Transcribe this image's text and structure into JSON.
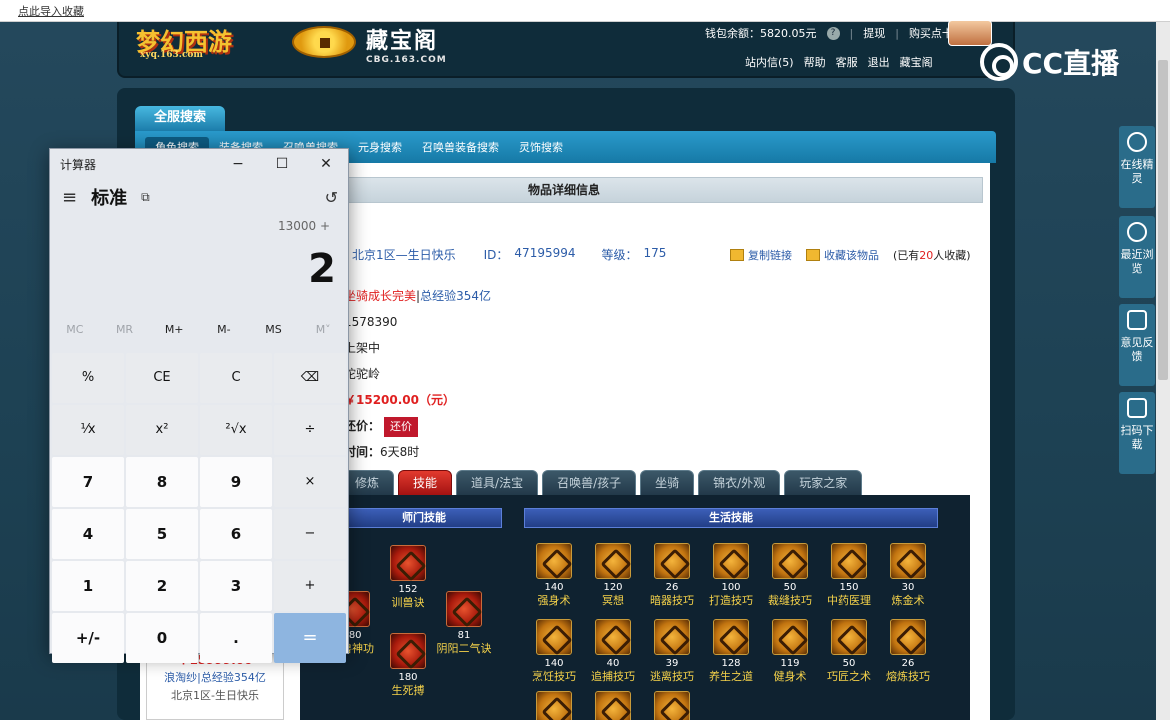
{
  "browser": {
    "bookmark_link": "点此导入收藏"
  },
  "header": {
    "logo_game": "梦幻西游",
    "logo_game_url": "xyq.163.com",
    "logo_site": "藏宝阁",
    "logo_site_url": "CBG.163.COM",
    "wallet_label": "钱包余额：5820.05元",
    "wallet_help": "?",
    "withdraw": "提现",
    "buy_card": "购买点卡",
    "user_nav": [
      "站内信(5)",
      "帮助",
      "客服",
      "退出",
      "藏宝阁"
    ],
    "cc_logo": "CC直播"
  },
  "search": {
    "tab": "全服搜索",
    "subnav": [
      "角色搜索",
      "装备搜索",
      "召唤兽搜索",
      "元身搜索",
      "召唤兽装备搜索",
      "灵饰搜索"
    ]
  },
  "detail": {
    "title": "物品详细信息",
    "server": "北京1区—生日快乐",
    "id_label": "ID：",
    "id_value": "47195994",
    "level_label": "等级：",
    "level_value": "175",
    "copy_link": "复制链接",
    "favorite": "收藏该物品",
    "fav_count_prefix": "(已有",
    "fav_count": "20",
    "fav_count_suffix": "人收藏)",
    "line1_red": "坐骑成长完美",
    "line1_sep": "|",
    "line1_blue": "总经验354亿",
    "line2": "1578390",
    "line3": "上架中",
    "line4": "陀驼岭",
    "price": "￥15200.00（元）",
    "bargain_label": "还价：",
    "bargain_btn": "还价",
    "time_label": "时间：",
    "time_value": "6天8时"
  },
  "tabs": [
    {
      "label": "修炼",
      "active": false
    },
    {
      "label": "技能",
      "active": true
    },
    {
      "label": "道具/法宝",
      "active": false
    },
    {
      "label": "召唤兽/孩子",
      "active": false
    },
    {
      "label": "坐骑",
      "active": false
    },
    {
      "label": "锦衣/外观",
      "active": false
    },
    {
      "label": "玩家之家",
      "active": false
    }
  ],
  "skills": {
    "school_title": "师门技能",
    "life_title": "生活技能",
    "school": [
      {
        "lv": "152",
        "name": "训兽诀"
      },
      {
        "lv": "180",
        "name": "魔兽神功"
      },
      {
        "lv": "81",
        "name": "阴阳二气诀"
      },
      {
        "lv": "180",
        "name": "生死搏"
      }
    ],
    "life": [
      {
        "lv": "140",
        "name": "强身术"
      },
      {
        "lv": "120",
        "name": "冥想"
      },
      {
        "lv": "26",
        "name": "暗器技巧"
      },
      {
        "lv": "100",
        "name": "打造技巧"
      },
      {
        "lv": "50",
        "name": "裁缝技巧"
      },
      {
        "lv": "150",
        "name": "中药医理"
      },
      {
        "lv": "30",
        "name": "炼金术"
      },
      {
        "lv": "140",
        "name": "烹饪技巧"
      },
      {
        "lv": "40",
        "name": "追捕技巧"
      },
      {
        "lv": "39",
        "name": "逃离技巧"
      },
      {
        "lv": "128",
        "name": "养生之道"
      },
      {
        "lv": "119",
        "name": "健身术"
      },
      {
        "lv": "50",
        "name": "巧匠之术"
      },
      {
        "lv": "26",
        "name": "熔炼技巧"
      }
    ]
  },
  "left_card": {
    "price": "￥15999.00",
    "exp": "浪淘纱|总经验354亿",
    "server": "北京1区-生日快乐"
  },
  "right_rail": [
    {
      "label": "在线精灵",
      "icon": "sprite-icon"
    },
    {
      "label": "最近浏览",
      "icon": "clock-icon"
    },
    {
      "label": "意见反馈",
      "icon": "edit-icon"
    },
    {
      "label": "扫码下载",
      "icon": "qr-scan-icon"
    }
  ],
  "calculator": {
    "window_title": "计算器",
    "mode": "标准",
    "expression": "13000 +",
    "display": "2",
    "memory": [
      "MC",
      "MR",
      "M+",
      "M-",
      "MS",
      "M˅"
    ],
    "keys": [
      "%",
      "CE",
      "C",
      "⌫",
      "¹⁄x",
      "x²",
      "²√x",
      "÷",
      "7",
      "8",
      "9",
      "×",
      "4",
      "5",
      "6",
      "−",
      "1",
      "2",
      "3",
      "+",
      "+/-",
      "0",
      ".",
      "="
    ]
  }
}
